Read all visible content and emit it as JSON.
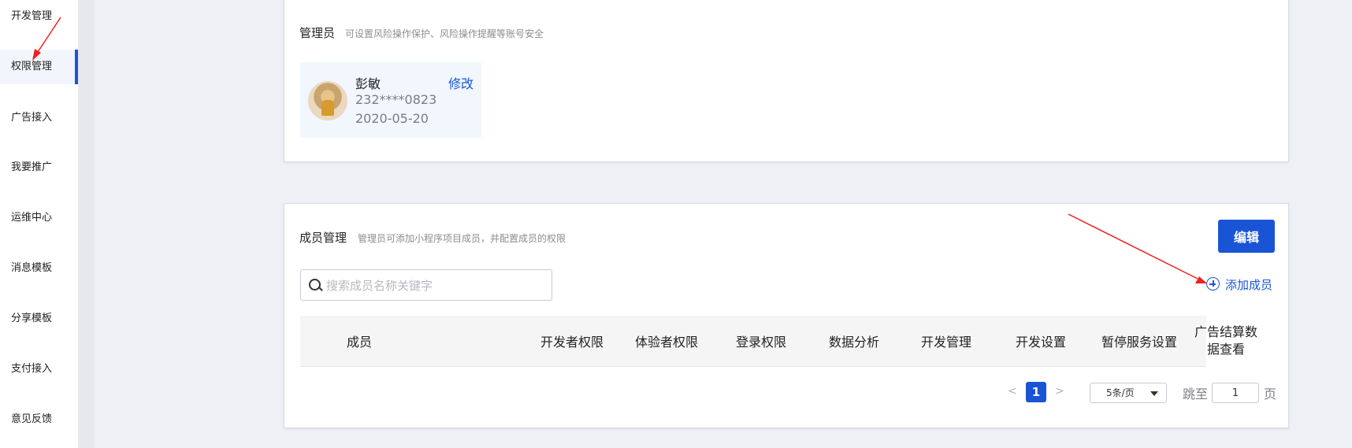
{
  "sidebar": {
    "items": [
      {
        "label": "开发管理",
        "active": false
      },
      {
        "label": "权限管理",
        "active": true
      },
      {
        "label": "广告接入",
        "active": false
      },
      {
        "label": "我要推广",
        "active": false
      },
      {
        "label": "运维中心",
        "active": false
      },
      {
        "label": "消息模板",
        "active": false
      },
      {
        "label": "分享模板",
        "active": false
      },
      {
        "label": "支付接入",
        "active": false
      },
      {
        "label": "意见反馈",
        "active": false
      }
    ]
  },
  "admin_card": {
    "title": "管理员",
    "description": "可设置风险操作保护、风险操作提醒等账号安全",
    "admin": {
      "name": "彭敏",
      "phone": "232****0823",
      "date": "2020-05-20",
      "edit_label": "修改"
    }
  },
  "member_card": {
    "title": "成员管理",
    "description": "管理员可添加小程序项目成员，并配置成员的权限",
    "edit_button": "编辑",
    "search_placeholder": "搜索成员名称关键字",
    "add_member_label": "添加成员",
    "columns": [
      "成员",
      "开发者权限",
      "体验者权限",
      "登录权限",
      "数据分析",
      "开发管理",
      "开发设置",
      "暂停服务设置",
      "广告结算数据查看"
    ],
    "pagination": {
      "prev": "<",
      "current_page": "1",
      "next": ">",
      "page_size": "5条/页",
      "jump_label": "跳至",
      "jump_value": "1",
      "page_suffix": "页"
    }
  },
  "colors": {
    "primary": "#1a54d6",
    "annotation_arrow": "#f02020"
  }
}
